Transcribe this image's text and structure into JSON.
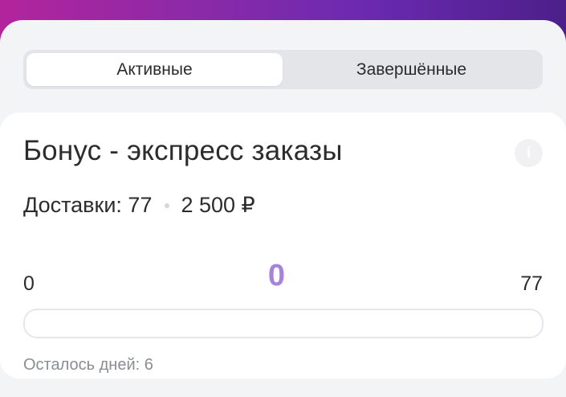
{
  "tabs": {
    "active_label": "Активные",
    "completed_label": "Завершённые",
    "selected": "active"
  },
  "card": {
    "title": "Бонус - экспресс заказы",
    "info_icon": "info-icon",
    "info_glyph": "i",
    "deliveries_text": "Доставки: 77",
    "amount_text": "2 500 ₽",
    "range_min": "0",
    "range_current": "0",
    "range_max": "77",
    "progress_fraction": 0,
    "days_left_text": "Осталось дней: 6"
  },
  "colors": {
    "accent": "#a582df",
    "header_gradient_start": "#b3249c",
    "header_gradient_end": "#4c1f8a"
  }
}
